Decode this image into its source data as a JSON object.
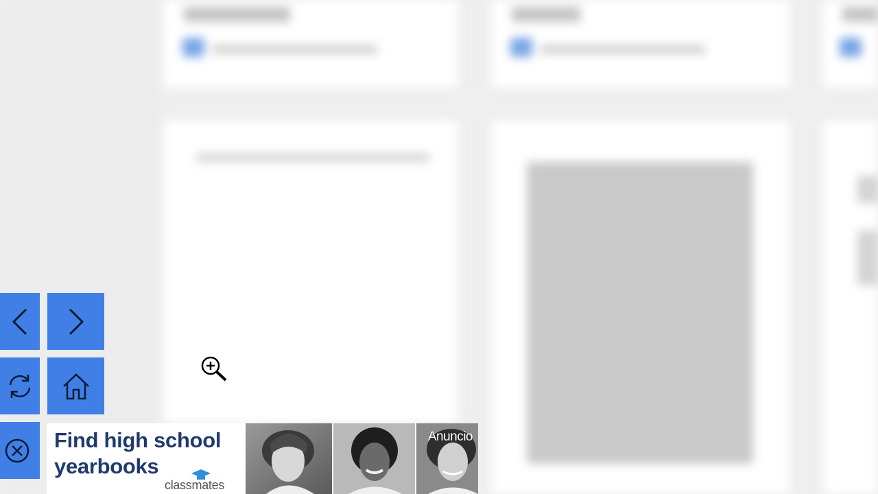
{
  "controls": {
    "back_label": "Back",
    "forward_label": "Forward",
    "refresh_label": "Refresh",
    "home_label": "Home",
    "close_label": "Close",
    "accent_color": "#3f7fe6"
  },
  "ad": {
    "headline": "Find high school yearbooks",
    "brand": "classmates",
    "label": "Anuncio",
    "headline_color": "#203a6e"
  },
  "icons": [
    "chevron-left-icon",
    "chevron-right-icon",
    "refresh-icon",
    "home-icon",
    "close-icon",
    "zoom-in-cursor-icon",
    "graduation-cap-icon"
  ]
}
